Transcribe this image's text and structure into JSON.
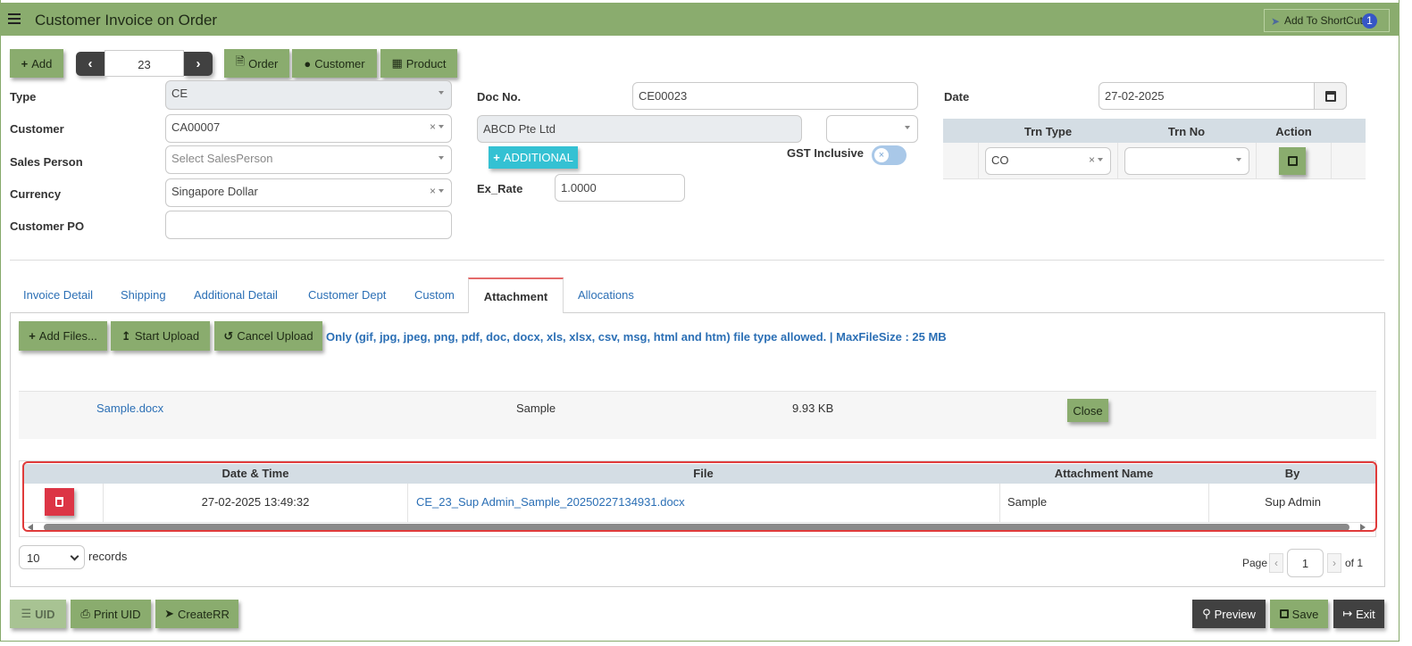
{
  "header": {
    "title": "Customer Invoice on Order",
    "shortcut_label": "Add To ShortCut",
    "shortcut_badge": "1"
  },
  "toolbar": {
    "add_label": "Add",
    "record_number": "23",
    "order_label": "Order",
    "customer_label": "Customer",
    "product_label": "Product"
  },
  "form": {
    "type_label": "Type",
    "type_value": "CE",
    "customer_label": "Customer",
    "customer_value": "CA00007",
    "salesperson_label": "Sales Person",
    "salesperson_placeholder": "Select SalesPerson",
    "currency_label": "Currency",
    "currency_value": "Singapore Dollar",
    "customer_po_label": "Customer PO",
    "customer_po_value": "",
    "doc_no_label": "Doc No.",
    "doc_no_value": "CE00023",
    "customer_name_value": "ABCD Pte Ltd",
    "additional_label": "ADDITIONAL",
    "gst_label": "GST Inclusive",
    "ex_rate_label": "Ex_Rate",
    "ex_rate_value": "1.0000",
    "date_label": "Date",
    "date_value": "27-02-2025"
  },
  "trn_table": {
    "headers": [
      "Trn Type",
      "Trn No",
      "Action"
    ],
    "trn_type_value": "CO",
    "trn_no_value": ""
  },
  "tabs": [
    "Invoice Detail",
    "Shipping",
    "Additional Detail",
    "Customer Dept",
    "Custom",
    "Attachment",
    "Allocations"
  ],
  "active_tab": "Attachment",
  "attachment": {
    "add_files_label": "Add Files...",
    "start_upload_label": "Start Upload",
    "cancel_upload_label": "Cancel Upload",
    "note": "Only (gif, jpg, jpeg, png, pdf, doc, docx, xls, xlsx, csv, msg, html and htm) file type allowed. | MaxFileSize : 25 MB",
    "pending_file": {
      "name": "Sample.docx",
      "label": "Sample",
      "size": "9.93 KB",
      "close_label": "Close"
    },
    "grid_headers": [
      "Date & Time",
      "File",
      "Attachment Name",
      "By"
    ],
    "rows": [
      {
        "datetime": "27-02-2025 13:49:32",
        "file": "CE_23_Sup Admin_Sample_20250227134931.docx",
        "name": "Sample",
        "by": "Sup Admin"
      }
    ]
  },
  "pager": {
    "page_size": "10",
    "records_label": "records",
    "page_label": "Page",
    "page_value": "1",
    "of_label": "of 1"
  },
  "footer": {
    "uid_label": "UID",
    "print_uid_label": "Print UID",
    "createrr_label": "CreateRR",
    "preview_label": "Preview",
    "save_label": "Save",
    "exit_label": "Exit"
  },
  "colors": {
    "header_green": "#8aac6e",
    "dark_button": "#414141",
    "danger": "#dc3545",
    "link_blue": "#2b6fb5"
  }
}
